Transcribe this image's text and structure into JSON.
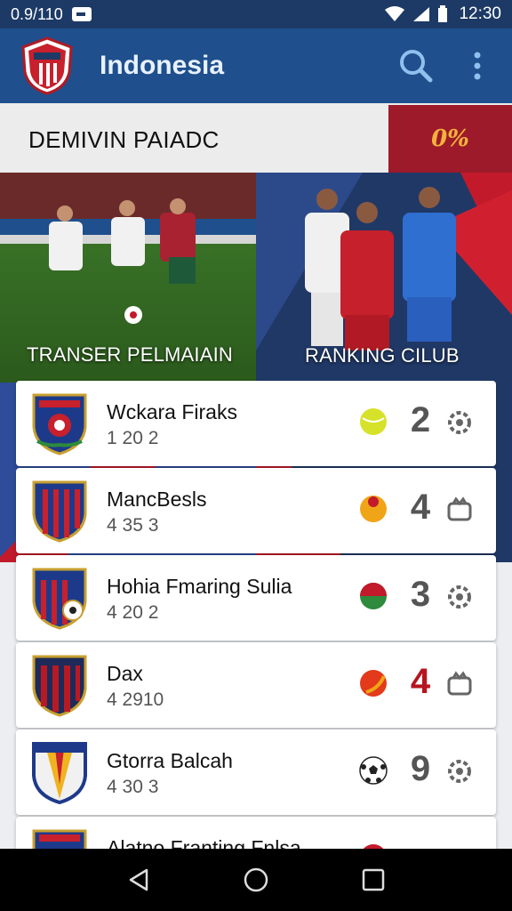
{
  "status_bar": {
    "left_text": "0.9/110",
    "time": "12:30"
  },
  "app_bar": {
    "title": "Indonesia",
    "logo_icon": "club-crest-icon",
    "search_icon": "search-icon",
    "menu_icon": "more-vert-icon"
  },
  "promo": {
    "title": "DEMIVIN PAIADC",
    "badge": "0%"
  },
  "hero": {
    "left_label": "TRANSER PELMAIAIN",
    "right_label": "RANKING CILUB"
  },
  "clubs": [
    {
      "name": "Wckara Firaks",
      "stats": "1 20 2",
      "rank": "2",
      "ball_color": "#d6e22a",
      "action_icon": "gear-icon"
    },
    {
      "name": "MancBesls",
      "stats": "4 35 3",
      "rank": "4",
      "ball_color": "#f0a417",
      "action_icon": "badge-icon"
    },
    {
      "name": "Hohia Fmaring Sulia",
      "stats": "4 20 2",
      "rank": "3",
      "ball_color": "#2e8a3c",
      "action_icon": "gear-icon"
    },
    {
      "name": "Dax",
      "stats": "4 2910",
      "rank": "4",
      "ball_color": "#e23a1a",
      "action_icon": "badge-icon"
    },
    {
      "name": "Gtorra Balcah",
      "stats": "4 30 3",
      "rank": "9",
      "ball_color": "#ffffff",
      "action_icon": "gear-icon"
    },
    {
      "name": "Alatno Franting Fnlsa",
      "stats": "",
      "rank": "",
      "ball_color": "#c21a2a",
      "action_icon": "gear-icon"
    }
  ]
}
